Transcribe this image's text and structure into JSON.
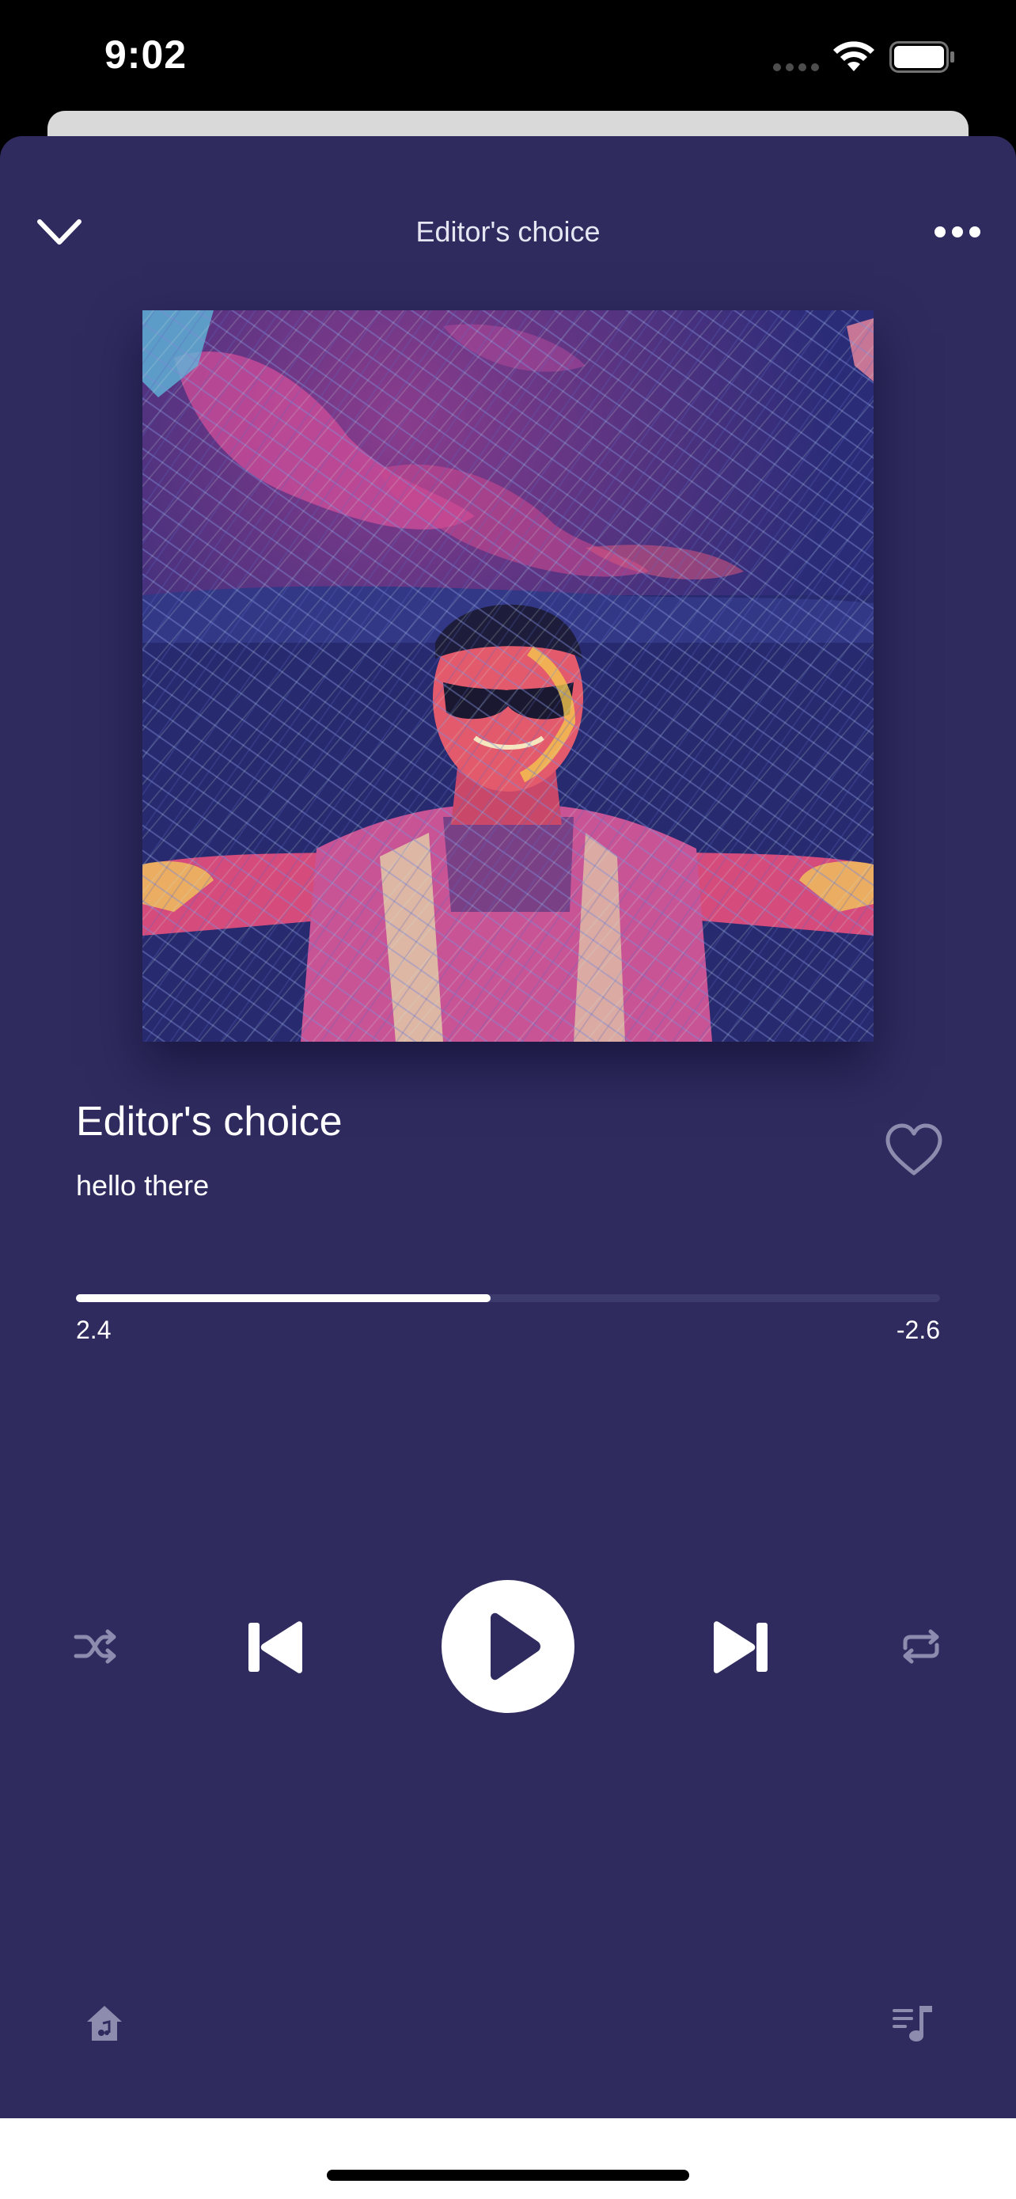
{
  "status_bar": {
    "time": "9:02"
  },
  "header": {
    "title": "Editor's choice"
  },
  "track": {
    "title": "Editor's choice",
    "artist": "hello there"
  },
  "progress": {
    "elapsed": "2.4",
    "remaining": "-2.6",
    "fraction": 0.48
  },
  "icons": {
    "collapse": "chevron-down-icon",
    "more": "more-horizontal-icon",
    "like": "heart-outline-icon",
    "shuffle": "shuffle-icon",
    "previous": "skip-previous-icon",
    "play": "play-icon",
    "next": "skip-next-icon",
    "repeat": "repeat-icon",
    "home": "home-music-icon",
    "queue": "queue-music-icon"
  },
  "colors": {
    "background": "#2f2b5f",
    "accent": "#ffffff",
    "muted_icon": "#8e8cae",
    "track_bar": "#3d3a6e"
  }
}
